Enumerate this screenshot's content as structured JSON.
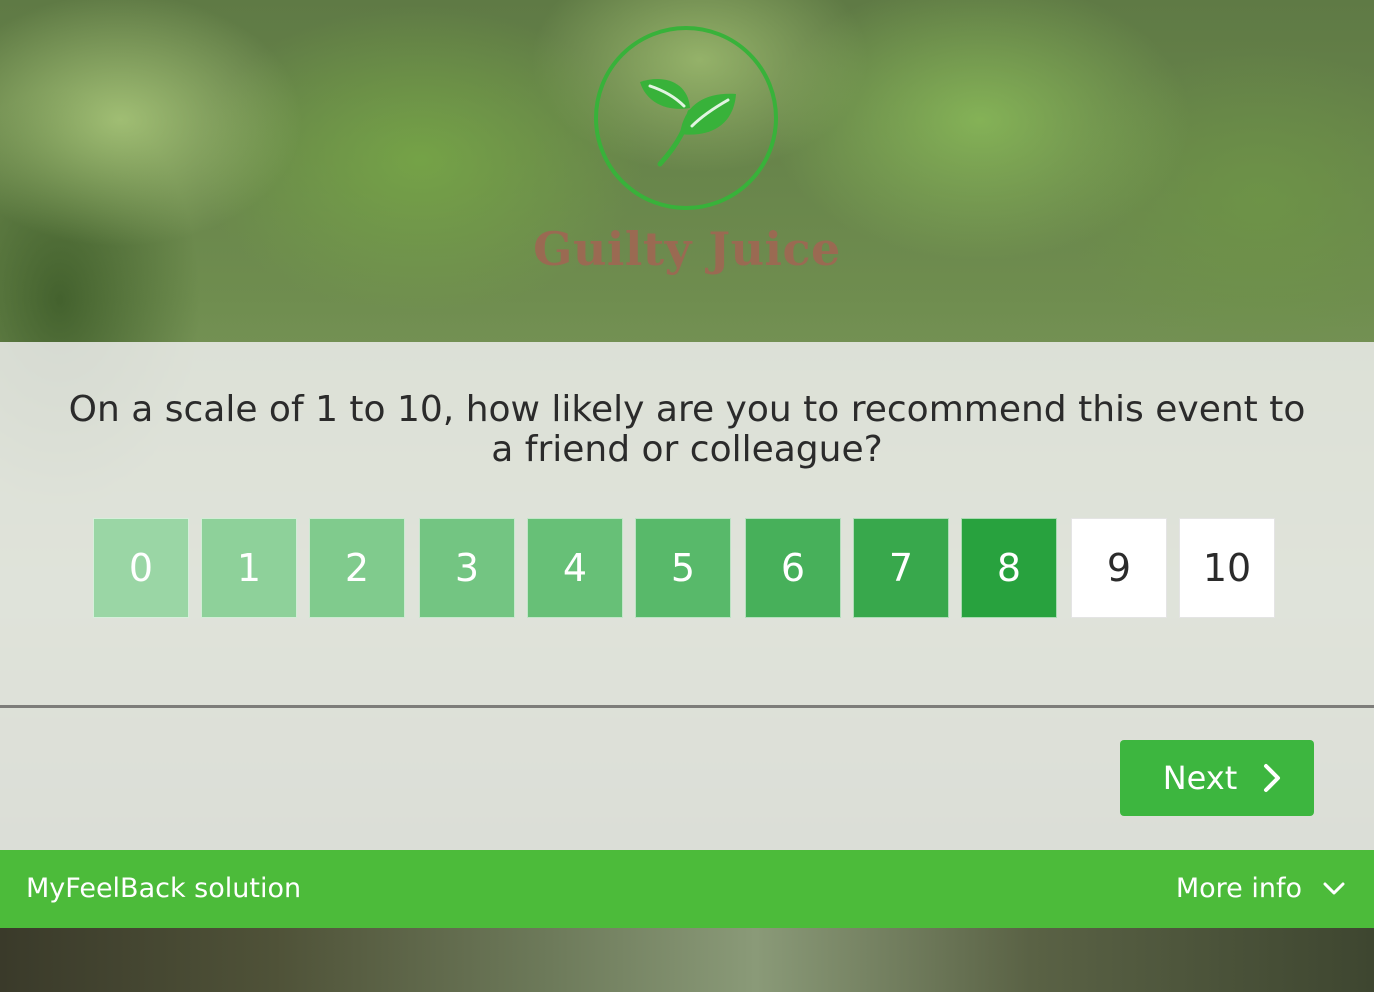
{
  "brand": {
    "name": "Guilty Juice",
    "logo_icon": "leaf-icon",
    "accent_color": "#38b23a",
    "brand_color": "#9a6a52"
  },
  "survey": {
    "question": "On a scale of 1 to 10, how likely are you to recommend this event to a friend or colleague?",
    "scale": [
      "0",
      "1",
      "2",
      "3",
      "4",
      "5",
      "6",
      "7",
      "8",
      "9",
      "10"
    ],
    "selected_value": "8"
  },
  "actions": {
    "next_label": "Next",
    "next_icon": "chevron-right-icon"
  },
  "footer": {
    "solution_label": "MyFeelBack solution",
    "more_info_label": "More info",
    "more_info_icon": "chevron-down-icon",
    "background_color": "#4cbb3a"
  }
}
